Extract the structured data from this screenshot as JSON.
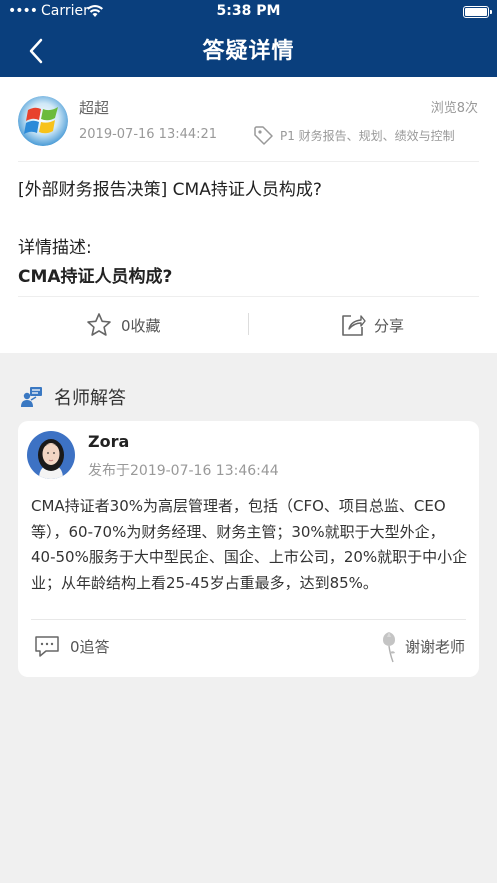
{
  "status_bar": {
    "carrier": "Carrier",
    "time": "5:38 PM"
  },
  "nav": {
    "title": "答疑详情"
  },
  "question": {
    "user_name": "超超",
    "views": "浏览8次",
    "date": "2019-07-16 13:44:21",
    "tag": "P1  财务报告、规划、绩效与控制",
    "title": "[外部财务报告决策] CMA持证人员构成?",
    "detail_label": "详情描述:",
    "detail_text": "CMA持证人员构成?",
    "favorite_label": "0收藏",
    "share_label": "分享"
  },
  "section": {
    "title": "名师解答"
  },
  "answer": {
    "teacher_name": "Zora",
    "date": "发布于2019-07-16 13:46:44",
    "text": "CMA持证者30%为高层管理者，包括（CFO、项目总监、CEO等），60-70%为财务经理、财务主管；30%就职于大型外企，40-50%服务于大中型民企、国企、上市公司，20%就职于中小企业；从年龄结构上看25-45岁占重最多，达到85%。",
    "followup_label": "0追答",
    "thanks_label": "谢谢老师"
  },
  "colors": {
    "nav_bg": "#0a3f7d",
    "page_bg": "#f0f0f0"
  }
}
